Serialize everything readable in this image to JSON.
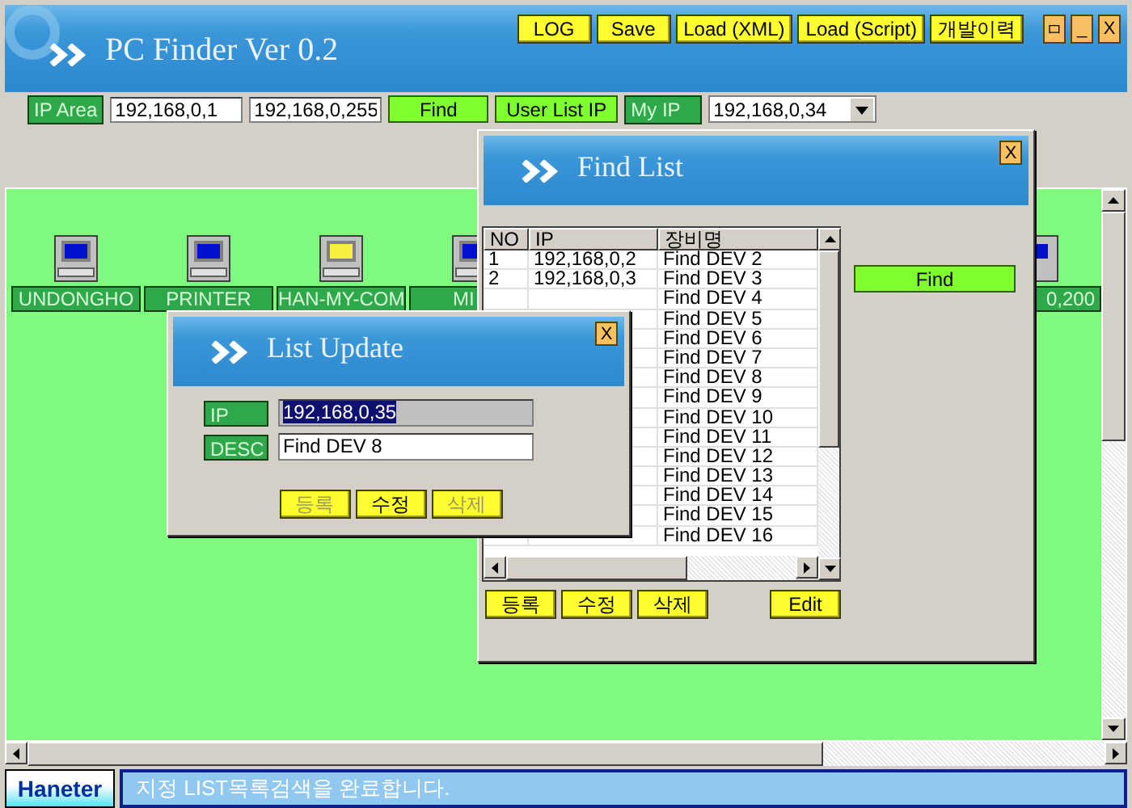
{
  "window": {
    "title": "PC Finder Ver 0.2",
    "menu_buttons": [
      {
        "label": "LOG"
      },
      {
        "label": "Save"
      },
      {
        "label": "Load (XML)"
      },
      {
        "label": "Load (Script)"
      },
      {
        "label": "개발이력"
      }
    ],
    "window_buttons": [
      {
        "label": "ㅁ"
      },
      {
        "label": "_"
      },
      {
        "label": "X"
      }
    ]
  },
  "toolbar": {
    "ip_area_label": "IP Area",
    "ip_start": "192,168,0,1",
    "ip_end": "192,168,0,255",
    "find_button": "Find",
    "user_list_button": "User List IP",
    "my_ip_label": "My IP",
    "my_ip_value": "192,168,0,34"
  },
  "devices": [
    {
      "name": "UNDONGHO",
      "color": "#0010d0"
    },
    {
      "name": "PRINTER",
      "color": "#0010d0"
    },
    {
      "name": "HAN-MY-COM",
      "color": "#f8f040"
    },
    {
      "name": "MI",
      "color": "#0010d0"
    }
  ],
  "device_right": {
    "name": "0,200"
  },
  "find_list": {
    "title": "Find List",
    "close": "X",
    "columns": [
      "NO",
      "IP",
      "장비명"
    ],
    "rows": [
      {
        "no": "1",
        "ip": "192,168,0,2",
        "name": "Find DEV 2"
      },
      {
        "no": "2",
        "ip": "192,168,0,3",
        "name": "Find DEV 3"
      },
      {
        "name": "Find DEV 4"
      },
      {
        "name": "Find DEV 5"
      },
      {
        "name": "Find DEV 6"
      },
      {
        "name": "Find DEV 7"
      },
      {
        "name": "Find DEV 8"
      },
      {
        "name": "Find DEV 9"
      },
      {
        "name": "Find DEV 10"
      },
      {
        "name": "Find DEV 11"
      },
      {
        "name": "Find DEV 12"
      },
      {
        "name": "Find DEV 13"
      },
      {
        "name": "Find DEV 14"
      },
      {
        "name": "Find DEV 15"
      },
      {
        "name": "Find DEV 16"
      }
    ],
    "find_button": "Find",
    "buttons": [
      {
        "label": "등록",
        "disabled": false
      },
      {
        "label": "수정",
        "disabled": false
      },
      {
        "label": "삭제",
        "disabled": false
      }
    ],
    "edit_button": "Edit"
  },
  "list_update": {
    "title": "List Update",
    "close": "X",
    "ip_label": "IP",
    "ip_value": "192,168,0,35",
    "ip_readonly": true,
    "ip_text_selected": true,
    "desc_label": "DESC",
    "desc_value": "Find DEV 8",
    "buttons": [
      {
        "label": "등록",
        "disabled": true
      },
      {
        "label": "수정",
        "disabled": false
      },
      {
        "label": "삭제",
        "disabled": true
      }
    ]
  },
  "status_bar": {
    "logo": "Haneter",
    "message": "지정 LIST목록검색을 완료합니다."
  }
}
